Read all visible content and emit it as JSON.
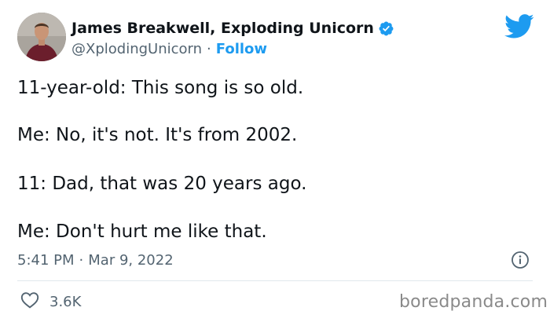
{
  "author": {
    "name": "James Breakwell, Exploding Unicorn",
    "handle": "@XplodingUnicorn",
    "separator": "·",
    "follow_label": "Follow"
  },
  "tweet": {
    "lines": [
      "11-year-old: This song is so old.",
      "Me: No, it's not. It's from 2002.",
      "11: Dad, that was 20 years ago.",
      "Me: Don't hurt me like that."
    ],
    "time": "5:41 PM",
    "date_separator": "·",
    "date": "Mar 9, 2022",
    "like_count": "3.6K"
  },
  "watermark": "boredpanda.com",
  "icons": {
    "platform": "twitter-bird-icon",
    "verified": "verified-badge-icon",
    "info": "info-icon",
    "like": "heart-icon"
  },
  "colors": {
    "accent": "#1d9bf0",
    "text_primary": "#0f1419",
    "text_secondary": "#536471",
    "divider": "#e1e8ed"
  }
}
